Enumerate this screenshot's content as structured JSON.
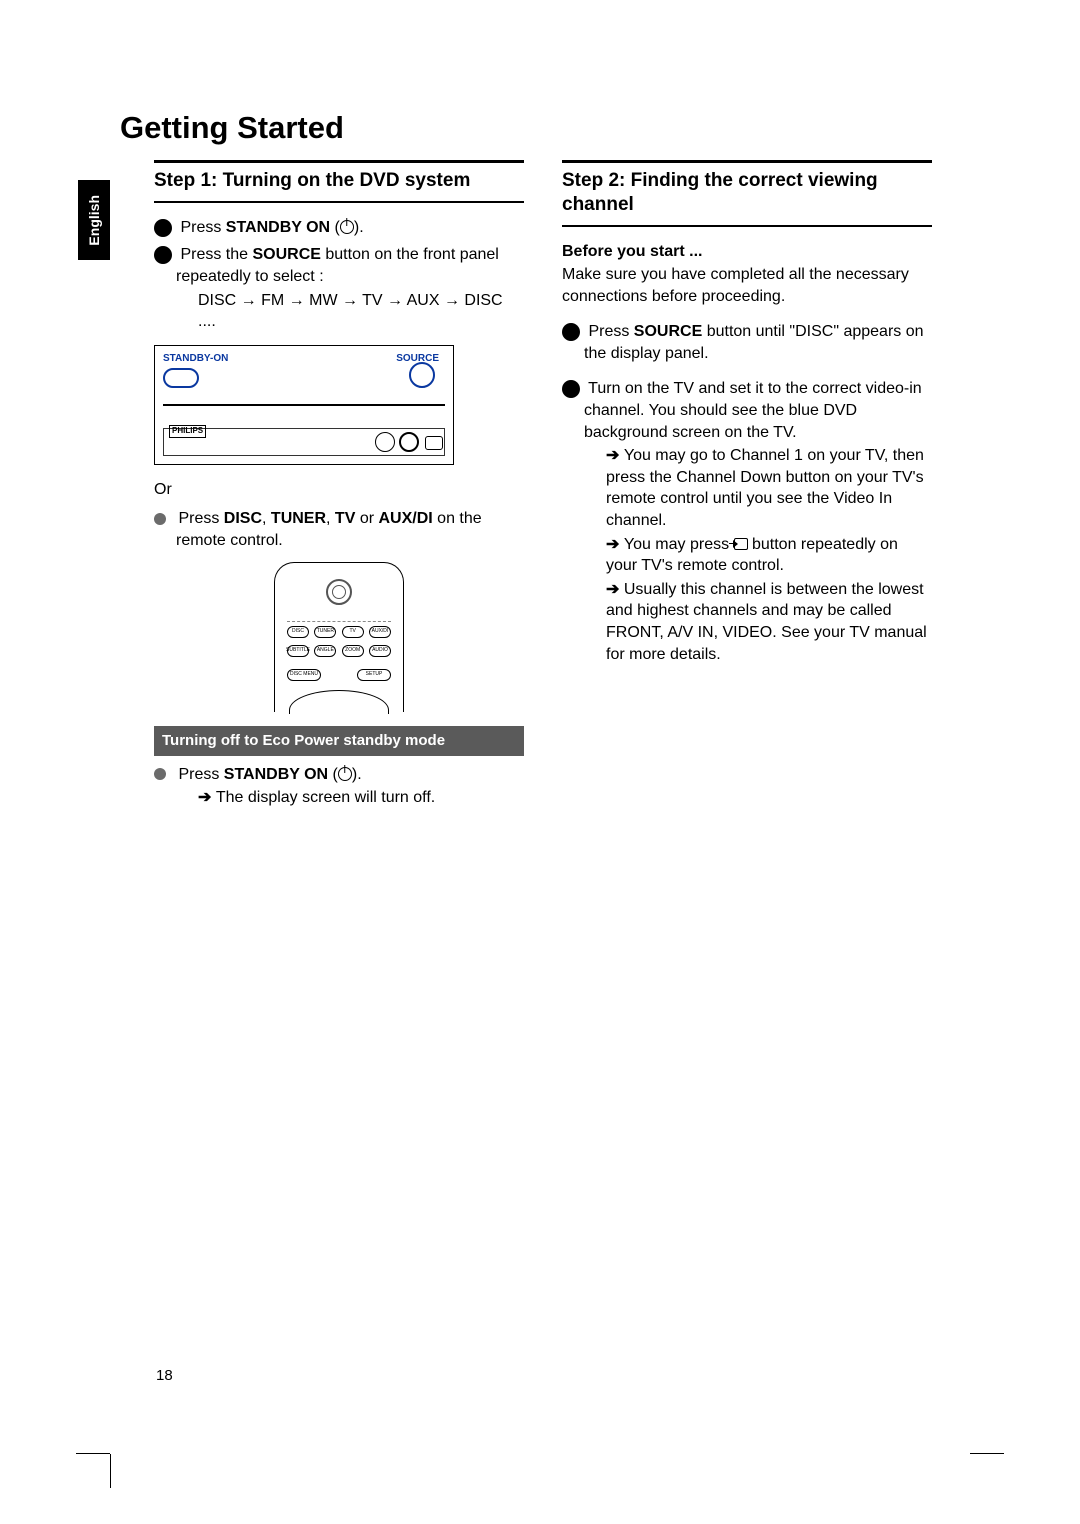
{
  "language_tab": "English",
  "page_title": "Getting Started",
  "page_number": "18",
  "left": {
    "step_heading": "Step 1:  Turning on the DVD system",
    "item1_pre": "Press ",
    "item1_bold": "STANDBY ON",
    "item1_post": " (",
    "item1_close": ").",
    "item2_pre": "Press the ",
    "item2_bold": "SOURCE",
    "item2_post": " button on the front panel repeatedly to select :",
    "item2_seq": "DISC → FM → MW → TV → AUX → DISC ....",
    "device_standby": "STANDBY-ON",
    "device_source": "SOURCE",
    "device_brand": "PHILIPS",
    "or": "Or",
    "item3_pre": "Press ",
    "item3_bold1": "DISC",
    "item3_sep1": ", ",
    "item3_bold2": "TUNER",
    "item3_sep2": ", ",
    "item3_bold3": "TV",
    "item3_sep3": " or ",
    "item3_bold4": "AUX/DI",
    "item3_post": " on the remote control.",
    "remote_btns_r1": [
      "DISC",
      "TUNER",
      "TV",
      "AUX/DI"
    ],
    "remote_btns_r2": [
      "SUBTITLE",
      "ANGLE",
      "ZOOM",
      "AUDIO"
    ],
    "remote_btns_r3": [
      "DISC MENU",
      "SETUP"
    ],
    "sub_bar": "Turning off to Eco Power standby mode",
    "eco_pre": "Press ",
    "eco_bold": "STANDBY ON",
    "eco_post": " (",
    "eco_close": ").",
    "eco_result": "The display screen will turn off."
  },
  "right": {
    "step_heading": "Step 2:  Finding the correct viewing channel",
    "before_label": "Before you start ...",
    "before_text": "Make sure you have completed all the necessary connections before proceeding.",
    "r1_pre": "Press ",
    "r1_bold": "SOURCE",
    "r1_post": " button until \"DISC\" appears on the display panel.",
    "r2_main": "Turn on the TV and set it to the correct video-in channel.  You should see the blue DVD background screen on the TV.",
    "r2_tip1": "You may go to Channel 1 on your TV, then press the Channel Down button on your TV's remote control until you see the Video In channel.",
    "r2_tip2a": "You may press ",
    "r2_tip2b": " button repeatedly on your TV's remote control.",
    "r2_tip3": "Usually this channel is between the lowest and highest channels and may be called FRONT, A/V IN, VIDEO. See your TV manual for more details."
  }
}
